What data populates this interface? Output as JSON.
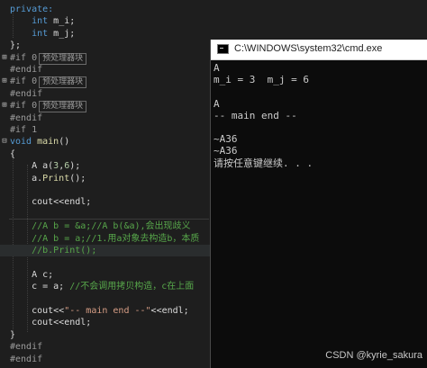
{
  "editor": {
    "lines": [
      {
        "g": "",
        "parts": [
          [
            "kw",
            "private:"
          ]
        ]
      },
      {
        "g": "",
        "parts": [
          [
            "",
            "    "
          ],
          [
            "kw",
            "int"
          ],
          [
            "",
            " m_i;"
          ]
        ]
      },
      {
        "g": "",
        "parts": [
          [
            "",
            "    "
          ],
          [
            "kw",
            "int"
          ],
          [
            "",
            " m_j;"
          ]
        ]
      },
      {
        "g": "",
        "parts": [
          [
            "",
            "};"
          ]
        ]
      },
      {
        "g": "+",
        "parts": [
          [
            "pp",
            "#if 0"
          ]
        ],
        "box": "预处理器块"
      },
      {
        "g": "",
        "parts": [
          [
            "pp",
            "#endif"
          ]
        ]
      },
      {
        "g": "+",
        "parts": [
          [
            "pp",
            "#if 0"
          ]
        ],
        "box": "预处理器块"
      },
      {
        "g": "",
        "parts": [
          [
            "pp",
            "#endif"
          ]
        ]
      },
      {
        "g": "+",
        "parts": [
          [
            "pp",
            "#if 0"
          ]
        ],
        "box": "预处理器块"
      },
      {
        "g": "",
        "parts": [
          [
            "pp",
            "#endif"
          ]
        ]
      },
      {
        "g": "",
        "parts": [
          [
            "pp",
            "#if 1"
          ]
        ]
      },
      {
        "g": "-",
        "parts": [
          [
            "kw",
            "void"
          ],
          [
            "",
            " "
          ],
          [
            "fn",
            "main"
          ],
          [
            "",
            "()"
          ]
        ]
      },
      {
        "g": "",
        "parts": [
          [
            "",
            "{"
          ]
        ]
      },
      {
        "g": "",
        "parts": [
          [
            "",
            "    A a("
          ],
          [
            "num",
            "3"
          ],
          [
            "",
            ","
          ],
          [
            "num",
            "6"
          ],
          [
            "",
            ");"
          ]
        ]
      },
      {
        "g": "",
        "parts": [
          [
            "",
            "    a."
          ],
          [
            "fn",
            "Print"
          ],
          [
            "",
            "();"
          ]
        ]
      },
      {
        "g": "",
        "parts": [
          [
            "",
            ""
          ]
        ]
      },
      {
        "g": "",
        "parts": [
          [
            "",
            "    cout<<endl;"
          ]
        ]
      },
      {
        "g": "",
        "parts": [
          [
            "",
            ""
          ]
        ]
      },
      {
        "g": "",
        "parts": [
          [
            "",
            "    "
          ],
          [
            "cm",
            "//A b = &a;//A b(&a),会出现歧义"
          ]
        ]
      },
      {
        "g": "",
        "parts": [
          [
            "",
            "    "
          ],
          [
            "cm",
            "//A b = a;//1.用a对象去构造b，本质"
          ]
        ]
      },
      {
        "g": "",
        "parts": [
          [
            "",
            "    "
          ],
          [
            "cm",
            "//b.Print();"
          ]
        ]
      },
      {
        "g": "",
        "parts": [
          [
            "",
            ""
          ]
        ]
      },
      {
        "g": "",
        "parts": [
          [
            "",
            "    A c;"
          ]
        ]
      },
      {
        "g": "",
        "parts": [
          [
            "",
            "    c = a; "
          ],
          [
            "cm",
            "//不会调用拷贝构造，c在上面"
          ]
        ]
      },
      {
        "g": "",
        "parts": [
          [
            "",
            ""
          ]
        ]
      },
      {
        "g": "",
        "parts": [
          [
            "",
            "    cout<<"
          ],
          [
            "str",
            "\"-- main end --\""
          ],
          [
            "",
            "<<endl;"
          ]
        ]
      },
      {
        "g": "",
        "parts": [
          [
            "",
            "    cout<<endl;"
          ]
        ]
      },
      {
        "g": "",
        "parts": [
          [
            "",
            "}"
          ]
        ]
      },
      {
        "g": "",
        "parts": [
          [
            "pp",
            "#endif"
          ]
        ]
      },
      {
        "g": "",
        "parts": [
          [
            "pp",
            "#endif"
          ]
        ]
      }
    ]
  },
  "console": {
    "title": "C:\\WINDOWS\\system32\\cmd.exe",
    "output": [
      "A",
      "m_i = 3  m_j = 6",
      "",
      "A",
      "-- main end --",
      "",
      "~A36",
      "~A36",
      "请按任意键继续. . ."
    ]
  },
  "watermark": "CSDN @kyrie_sakura"
}
